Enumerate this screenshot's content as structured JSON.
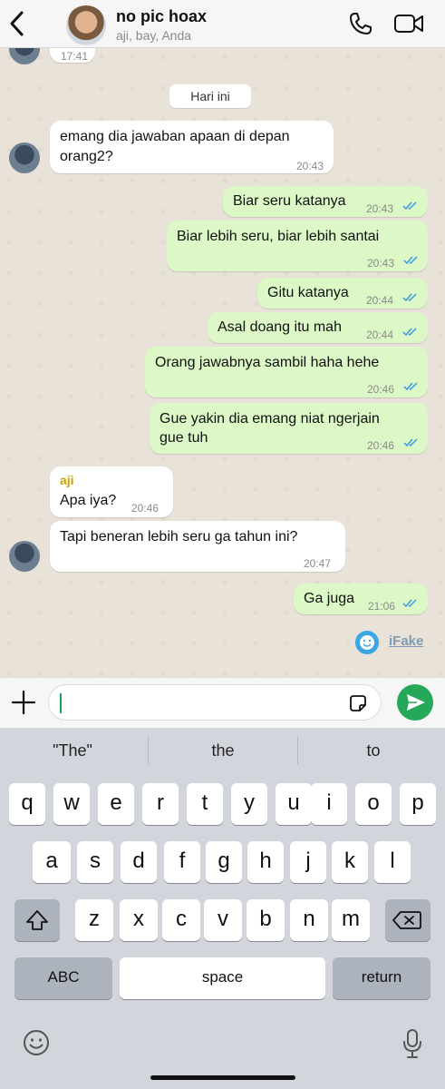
{
  "header": {
    "title": "no pic hoax",
    "subtitle": "aji, bay, Anda"
  },
  "chat": {
    "top_time": "17:41",
    "date_label": "Hari ini",
    "messages": [
      {
        "dir": "in",
        "line1": "emang dia jawaban apaan di depan",
        "line2": "orang2?",
        "time": "20:43"
      },
      {
        "dir": "out",
        "text": "Biar seru katanya",
        "time": "20:43"
      },
      {
        "dir": "out",
        "text": "Biar lebih seru, biar lebih santai",
        "time": "20:43"
      },
      {
        "dir": "out",
        "text": "Gitu katanya",
        "time": "20:44"
      },
      {
        "dir": "out",
        "text": "Asal doang itu mah",
        "time": "20:44"
      },
      {
        "dir": "out",
        "text": "Orang jawabnya sambil haha hehe",
        "time": "20:46"
      },
      {
        "dir": "out",
        "line1": "Gue yakin dia emang niat ngerjain",
        "line2": "gue tuh",
        "time": "20:46"
      },
      {
        "dir": "in",
        "sender": "aji",
        "text": "Apa iya?",
        "time": "20:46"
      },
      {
        "dir": "in",
        "text": "Tapi beneran lebih seru ga tahun ini?",
        "time": "20:47"
      },
      {
        "dir": "out",
        "text": "Ga juga",
        "time": "21:06"
      }
    ],
    "watermark": "iFake"
  },
  "colors": {
    "outgoing_bubble": "#dcf8c6",
    "incoming_bubble": "#ffffff",
    "read_ticks": "#3b9ae1",
    "send_button": "#25a85a",
    "sender_name": "#c9a200"
  },
  "keyboard": {
    "suggestions": [
      "\"The\"",
      "the",
      "to"
    ],
    "row1": [
      "q",
      "w",
      "e",
      "r",
      "t",
      "y",
      "u",
      "i",
      "o",
      "p"
    ],
    "row2": [
      "a",
      "s",
      "d",
      "f",
      "g",
      "h",
      "j",
      "k",
      "l"
    ],
    "row3": [
      "z",
      "x",
      "c",
      "v",
      "b",
      "n",
      "m"
    ],
    "abc_label": "ABC",
    "space_label": "space",
    "return_label": "return"
  }
}
